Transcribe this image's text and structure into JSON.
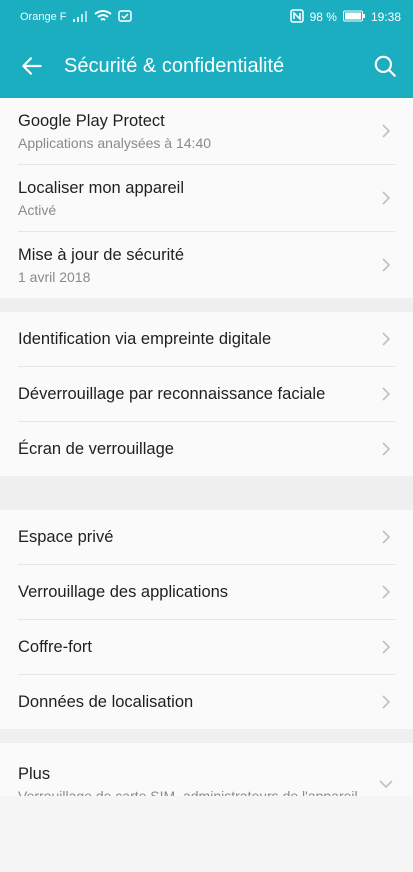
{
  "status_bar": {
    "carrier": "Orange F",
    "battery": "98 %",
    "time": "19:38"
  },
  "appbar": {
    "title": "Sécurité & confidentialité"
  },
  "groups": [
    {
      "items": [
        {
          "label": "Google Play Protect",
          "sub": "Applications analysées à 14:40"
        },
        {
          "label": "Localiser mon appareil",
          "sub": "Activé"
        },
        {
          "label": "Mise à jour de sécurité",
          "sub": "1 avril 2018"
        }
      ]
    },
    {
      "items": [
        {
          "label": "Identification via empreinte digitale"
        },
        {
          "label": "Déverrouillage par reconnaissance faciale"
        },
        {
          "label": "Écran de verrouillage"
        }
      ]
    },
    {
      "items": [
        {
          "label": "Espace privé"
        },
        {
          "label": "Verrouillage des applications"
        },
        {
          "label": "Coffre-fort"
        },
        {
          "label": "Données de localisation"
        }
      ]
    },
    {
      "items": [
        {
          "label": "Plus",
          "sub": "Verrouillage de carte SIM, administrateurs de l'appareil"
        }
      ]
    }
  ],
  "colors": {
    "accent": "#1aaec0"
  }
}
